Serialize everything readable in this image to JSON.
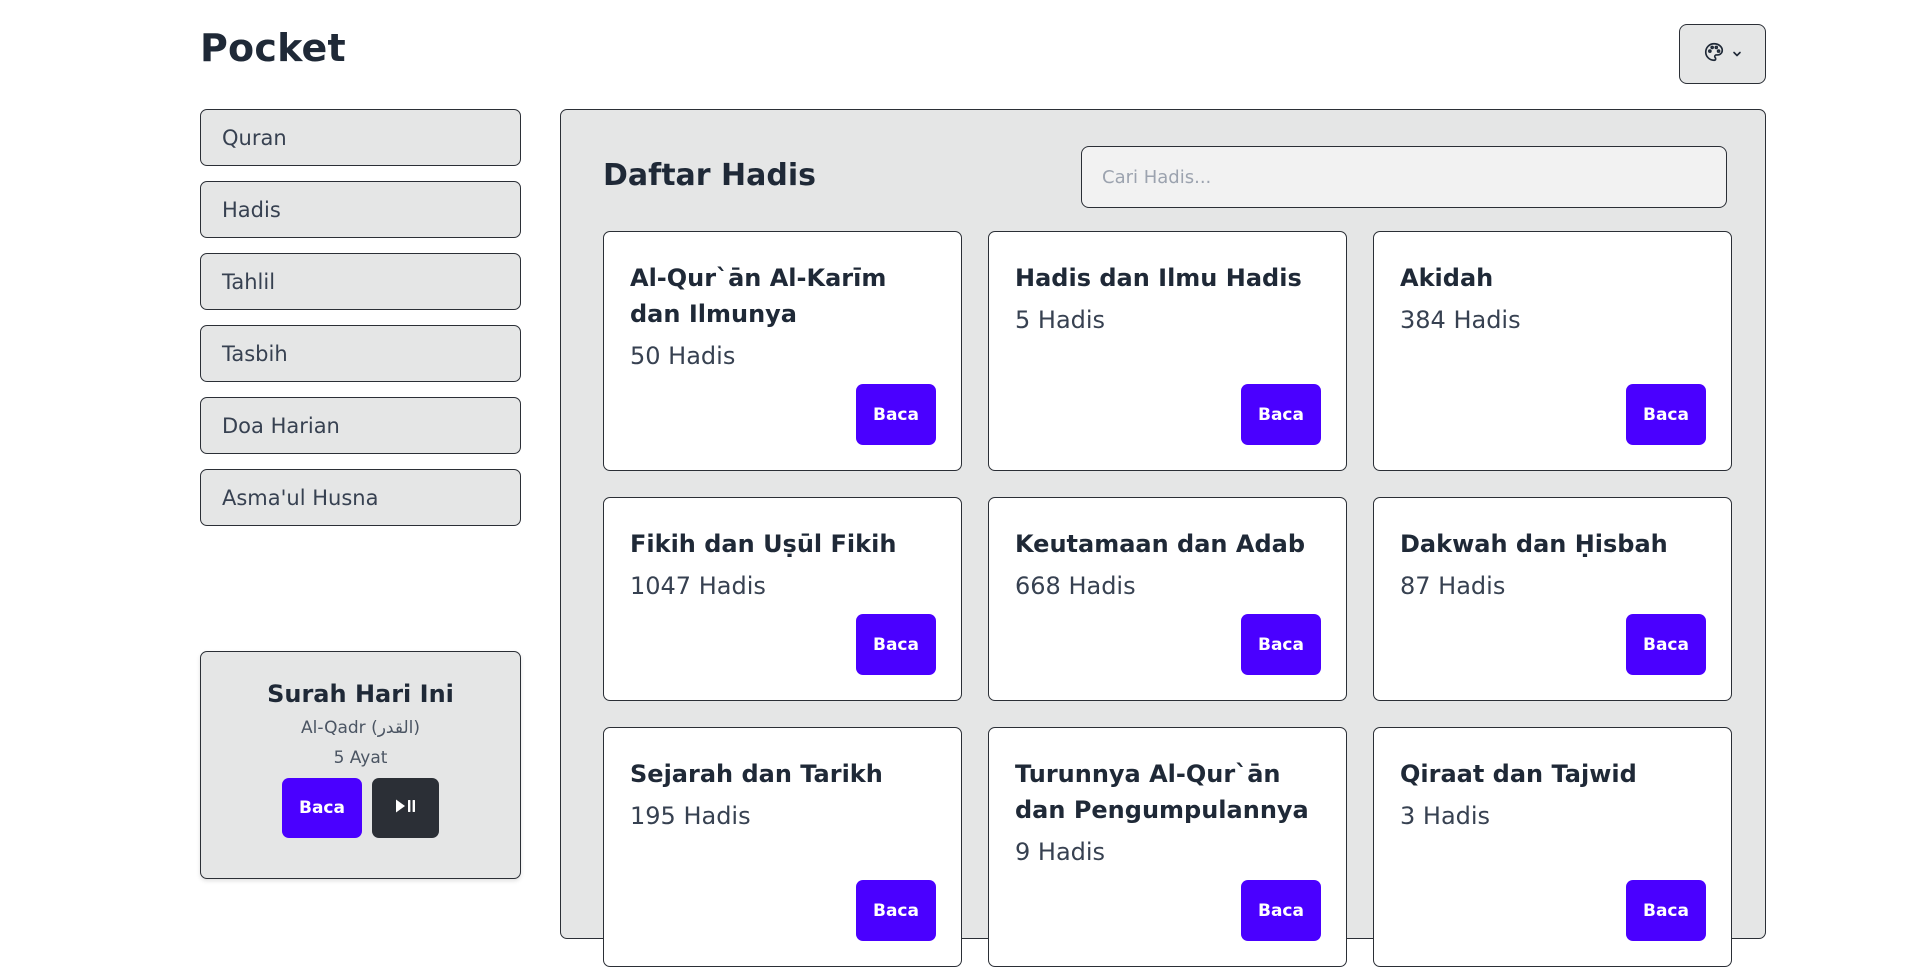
{
  "app": {
    "title": "Pocket"
  },
  "theme_button": {
    "icon": "palette-icon",
    "chevron": "chevron-down-icon"
  },
  "sidebar": {
    "items": [
      {
        "label": "Quran"
      },
      {
        "label": "Hadis"
      },
      {
        "label": "Tahlil"
      },
      {
        "label": "Tasbih"
      },
      {
        "label": "Doa Harian"
      },
      {
        "label": "Asma'ul Husna"
      }
    ]
  },
  "surah_today": {
    "title": "Surah Hari Ini",
    "name": "Al-Qadr (القدر)",
    "ayat": "5 Ayat",
    "read_label": "Baca",
    "play_icon": "play-pause-icon"
  },
  "main": {
    "title": "Daftar Hadis",
    "search_placeholder": "Cari Hadis...",
    "read_label": "Baca",
    "cards": [
      {
        "title": "Al-Qur`ān Al-Karīm dan Ilmunya",
        "count": "50 Hadis"
      },
      {
        "title": "Hadis dan Ilmu Hadis",
        "count": "5 Hadis"
      },
      {
        "title": "Akidah",
        "count": "384 Hadis"
      },
      {
        "title": "Fikih dan Uṣūl Fikih",
        "count": "1047 Hadis"
      },
      {
        "title": "Keutamaan dan Adab",
        "count": "668 Hadis"
      },
      {
        "title": "Dakwah dan Ḥisbah",
        "count": "87 Hadis"
      },
      {
        "title": "Sejarah dan Tarikh",
        "count": "195 Hadis"
      },
      {
        "title": "Turunnya Al-Qur`ān dan Pengumpulannya",
        "count": "9 Hadis"
      },
      {
        "title": "Qiraat dan Tajwid",
        "count": "3 Hadis"
      }
    ]
  },
  "colors": {
    "accent": "#4a00ff",
    "panel": "#e5e6e6",
    "border": "#2b2f36",
    "text": "#1f2937"
  }
}
